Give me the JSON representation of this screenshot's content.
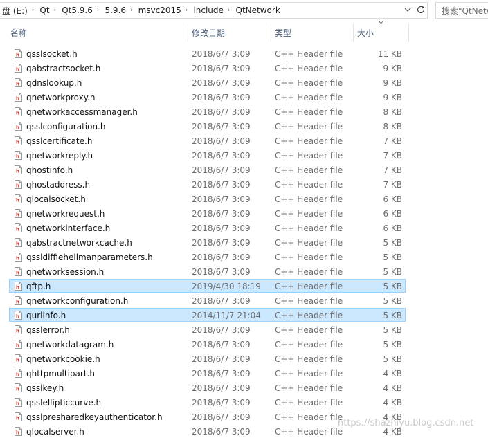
{
  "address_bar": {
    "crumbs": [
      "盘 (E:)",
      "Qt",
      "Qt5.9.6",
      "5.9.6",
      "msvc2015",
      "include",
      "QtNetwork"
    ],
    "search_placeholder": "搜索\"QtNetw"
  },
  "columns": {
    "name": "名称",
    "date": "修改日期",
    "type": "类型",
    "size": "大小"
  },
  "files": [
    {
      "name": "qsslsocket.h",
      "date": "2018/6/7 3:09",
      "type": "C++ Header file",
      "size": "11 KB",
      "selected": false
    },
    {
      "name": "qabstractsocket.h",
      "date": "2018/6/7 3:09",
      "type": "C++ Header file",
      "size": "9 KB",
      "selected": false
    },
    {
      "name": "qdnslookup.h",
      "date": "2018/6/7 3:09",
      "type": "C++ Header file",
      "size": "9 KB",
      "selected": false
    },
    {
      "name": "qnetworkproxy.h",
      "date": "2018/6/7 3:09",
      "type": "C++ Header file",
      "size": "9 KB",
      "selected": false
    },
    {
      "name": "qnetworkaccessmanager.h",
      "date": "2018/6/7 3:09",
      "type": "C++ Header file",
      "size": "8 KB",
      "selected": false
    },
    {
      "name": "qsslconfiguration.h",
      "date": "2018/6/7 3:09",
      "type": "C++ Header file",
      "size": "8 KB",
      "selected": false
    },
    {
      "name": "qsslcertificate.h",
      "date": "2018/6/7 3:09",
      "type": "C++ Header file",
      "size": "7 KB",
      "selected": false
    },
    {
      "name": "qnetworkreply.h",
      "date": "2018/6/7 3:09",
      "type": "C++ Header file",
      "size": "7 KB",
      "selected": false
    },
    {
      "name": "qhostinfo.h",
      "date": "2018/6/7 3:09",
      "type": "C++ Header file",
      "size": "7 KB",
      "selected": false
    },
    {
      "name": "qhostaddress.h",
      "date": "2018/6/7 3:09",
      "type": "C++ Header file",
      "size": "7 KB",
      "selected": false
    },
    {
      "name": "qlocalsocket.h",
      "date": "2018/6/7 3:09",
      "type": "C++ Header file",
      "size": "6 KB",
      "selected": false
    },
    {
      "name": "qnetworkrequest.h",
      "date": "2018/6/7 3:09",
      "type": "C++ Header file",
      "size": "6 KB",
      "selected": false
    },
    {
      "name": "qnetworkinterface.h",
      "date": "2018/6/7 3:09",
      "type": "C++ Header file",
      "size": "6 KB",
      "selected": false
    },
    {
      "name": "qabstractnetworkcache.h",
      "date": "2018/6/7 3:09",
      "type": "C++ Header file",
      "size": "5 KB",
      "selected": false
    },
    {
      "name": "qssldiffiehellmanparameters.h",
      "date": "2018/6/7 3:09",
      "type": "C++ Header file",
      "size": "5 KB",
      "selected": false
    },
    {
      "name": "qnetworksession.h",
      "date": "2018/6/7 3:09",
      "type": "C++ Header file",
      "size": "5 KB",
      "selected": false
    },
    {
      "name": "qftp.h",
      "date": "2019/4/30 18:19",
      "type": "C++ Header file",
      "size": "5 KB",
      "selected": true
    },
    {
      "name": "qnetworkconfiguration.h",
      "date": "2018/6/7 3:09",
      "type": "C++ Header file",
      "size": "5 KB",
      "selected": false
    },
    {
      "name": "qurlinfo.h",
      "date": "2014/11/7 21:04",
      "type": "C++ Header file",
      "size": "5 KB",
      "selected": true
    },
    {
      "name": "qsslerror.h",
      "date": "2018/6/7 3:09",
      "type": "C++ Header file",
      "size": "5 KB",
      "selected": false
    },
    {
      "name": "qnetworkdatagram.h",
      "date": "2018/6/7 3:09",
      "type": "C++ Header file",
      "size": "5 KB",
      "selected": false
    },
    {
      "name": "qnetworkcookie.h",
      "date": "2018/6/7 3:09",
      "type": "C++ Header file",
      "size": "5 KB",
      "selected": false
    },
    {
      "name": "qhttpmultipart.h",
      "date": "2018/6/7 3:09",
      "type": "C++ Header file",
      "size": "4 KB",
      "selected": false
    },
    {
      "name": "qsslkey.h",
      "date": "2018/6/7 3:09",
      "type": "C++ Header file",
      "size": "4 KB",
      "selected": false
    },
    {
      "name": "qsslellipticcurve.h",
      "date": "2018/6/7 3:09",
      "type": "C++ Header file",
      "size": "4 KB",
      "selected": false
    },
    {
      "name": "qsslpresharedkeyauthenticator.h",
      "date": "2018/6/7 3:09",
      "type": "C++ Header file",
      "size": "4 KB",
      "selected": false
    },
    {
      "name": "qlocalserver.h",
      "date": "2018/6/7 3:09",
      "type": "C++ Header file",
      "size": "4 KB",
      "selected": false
    }
  ],
  "icons": {
    "file": "cpp-header-file-icon",
    "refresh": "refresh-icon",
    "dropdown": "chevron-down-icon",
    "sort": "sort-descending-icon"
  },
  "colors": {
    "selected_bg": "#cce8ff",
    "selected_border": "#99d1ff",
    "header_text": "#4c607a",
    "icon_red": "#c8342c"
  },
  "watermark": "https://shazhiyu.blog.csdn.net"
}
